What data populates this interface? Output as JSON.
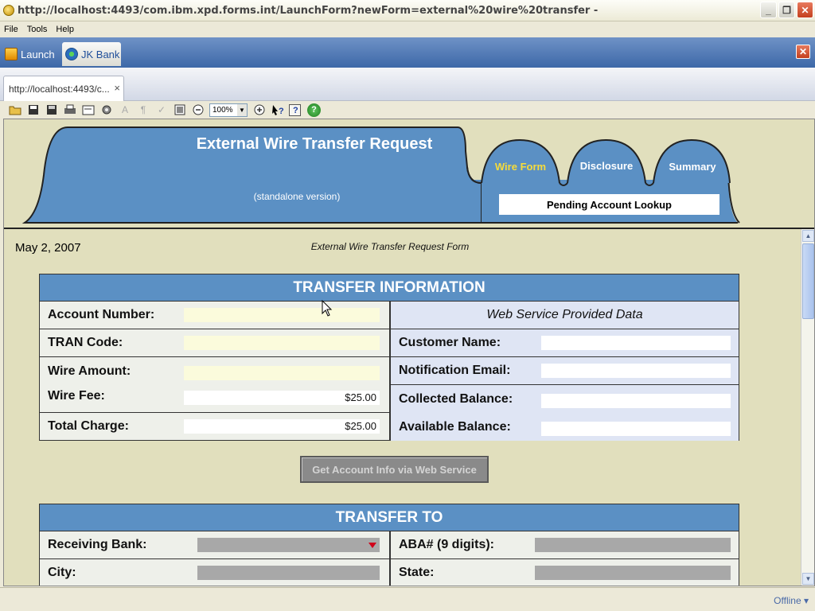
{
  "window": {
    "title": "http://localhost:4493/com.ibm.xpd.forms.int/LaunchForm?newForm=external%20wire%20transfer -",
    "buttons": {
      "minimize": "_",
      "restore": "❐",
      "close": "✕"
    }
  },
  "menu": [
    "File",
    "Tools",
    "Help"
  ],
  "app_tabs": {
    "launch": "Launch",
    "jk_bank": "JK Bank",
    "close": "✕"
  },
  "doc_tab": {
    "label": "http://localhost:4493/c...",
    "close": "×"
  },
  "toolbar": {
    "zoom": "100%"
  },
  "banner": {
    "title": "External Wire Transfer Request",
    "subtitle": "(standalone version)",
    "tabs": [
      "Wire Form",
      "Disclosure",
      "Summary"
    ],
    "active_tab": "Wire Form",
    "pending": "Pending Account Lookup",
    "colors": {
      "tab_fill": "#5b90c4",
      "active_text": "#f7dc3a"
    }
  },
  "form": {
    "date": "May 2, 2007",
    "title": "External Wire Transfer Request Form"
  },
  "transfer_info": {
    "heading": "TRANSFER INFORMATION",
    "account_number_label": "Account Number:",
    "tran_code_label": "TRAN Code:",
    "wire_amount_label": "Wire Amount:",
    "wire_fee_label": "Wire Fee:",
    "wire_fee_value": "$25.00",
    "total_charge_label": "Total Charge:",
    "total_charge_value": "$25.00",
    "ws_data": "Web Service Provided Data",
    "customer_name_label": "Customer Name:",
    "notification_email_label": "Notification Email:",
    "collected_balance_label": "Collected Balance:",
    "available_balance_label": "Available Balance:"
  },
  "get_account_button": "Get Account Info via Web Service",
  "transfer_to": {
    "heading": "TRANSFER TO",
    "receiving_bank_label": "Receiving Bank:",
    "aba_label": "ABA# (9 digits):",
    "city_label": "City:",
    "state_label": "State:"
  },
  "status": {
    "offline": "Offline ▾"
  }
}
